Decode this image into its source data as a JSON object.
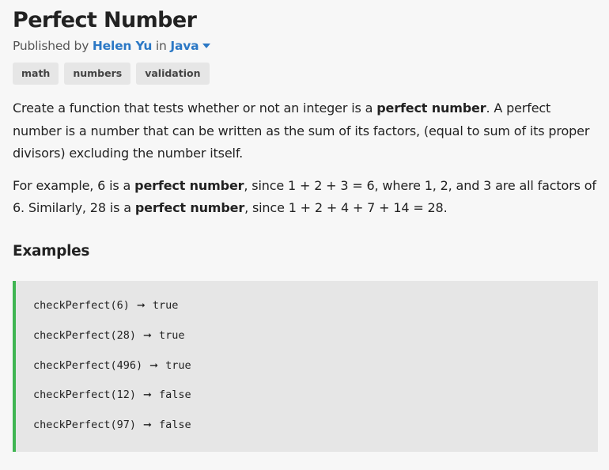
{
  "challenge": {
    "title": "Perfect Number",
    "published_by_prefix": "Published by",
    "author": "Helen Yu",
    "in_word": "in",
    "language": "Java"
  },
  "tags": [
    "math",
    "numbers",
    "validation"
  ],
  "description": {
    "p1": {
      "part1": "Create a function that tests whether or not an integer is a ",
      "bold": "perfect number",
      "part2": ". A perfect number is a number that can be written as the sum of its factors, (equal to sum of its proper divisors) excluding the number itself."
    },
    "p2": {
      "part1": "For example, 6 is a ",
      "bold1": "perfect number",
      "part2": ", since 1 + 2 + 3 = 6, where 1, 2, and 3 are all factors of 6. Similarly, 28 is a ",
      "bold2": "perfect number",
      "part3": ", since 1 + 2 + 4 + 7 + 14 = 28."
    }
  },
  "examples_heading": "Examples",
  "examples": [
    {
      "call": "checkPerfect(6)",
      "arrow": "➞",
      "result": "true"
    },
    {
      "call": "checkPerfect(28)",
      "arrow": "➞",
      "result": "true"
    },
    {
      "call": "checkPerfect(496)",
      "arrow": "➞",
      "result": "true"
    },
    {
      "call": "checkPerfect(12)",
      "arrow": "➞",
      "result": "false"
    },
    {
      "call": "checkPerfect(97)",
      "arrow": "➞",
      "result": "false"
    }
  ],
  "colors": {
    "link": "#2b78c5",
    "accent_bar": "#3fb552",
    "tag_bg": "#e6e6e6",
    "page_bg": "#f7f7f7"
  }
}
